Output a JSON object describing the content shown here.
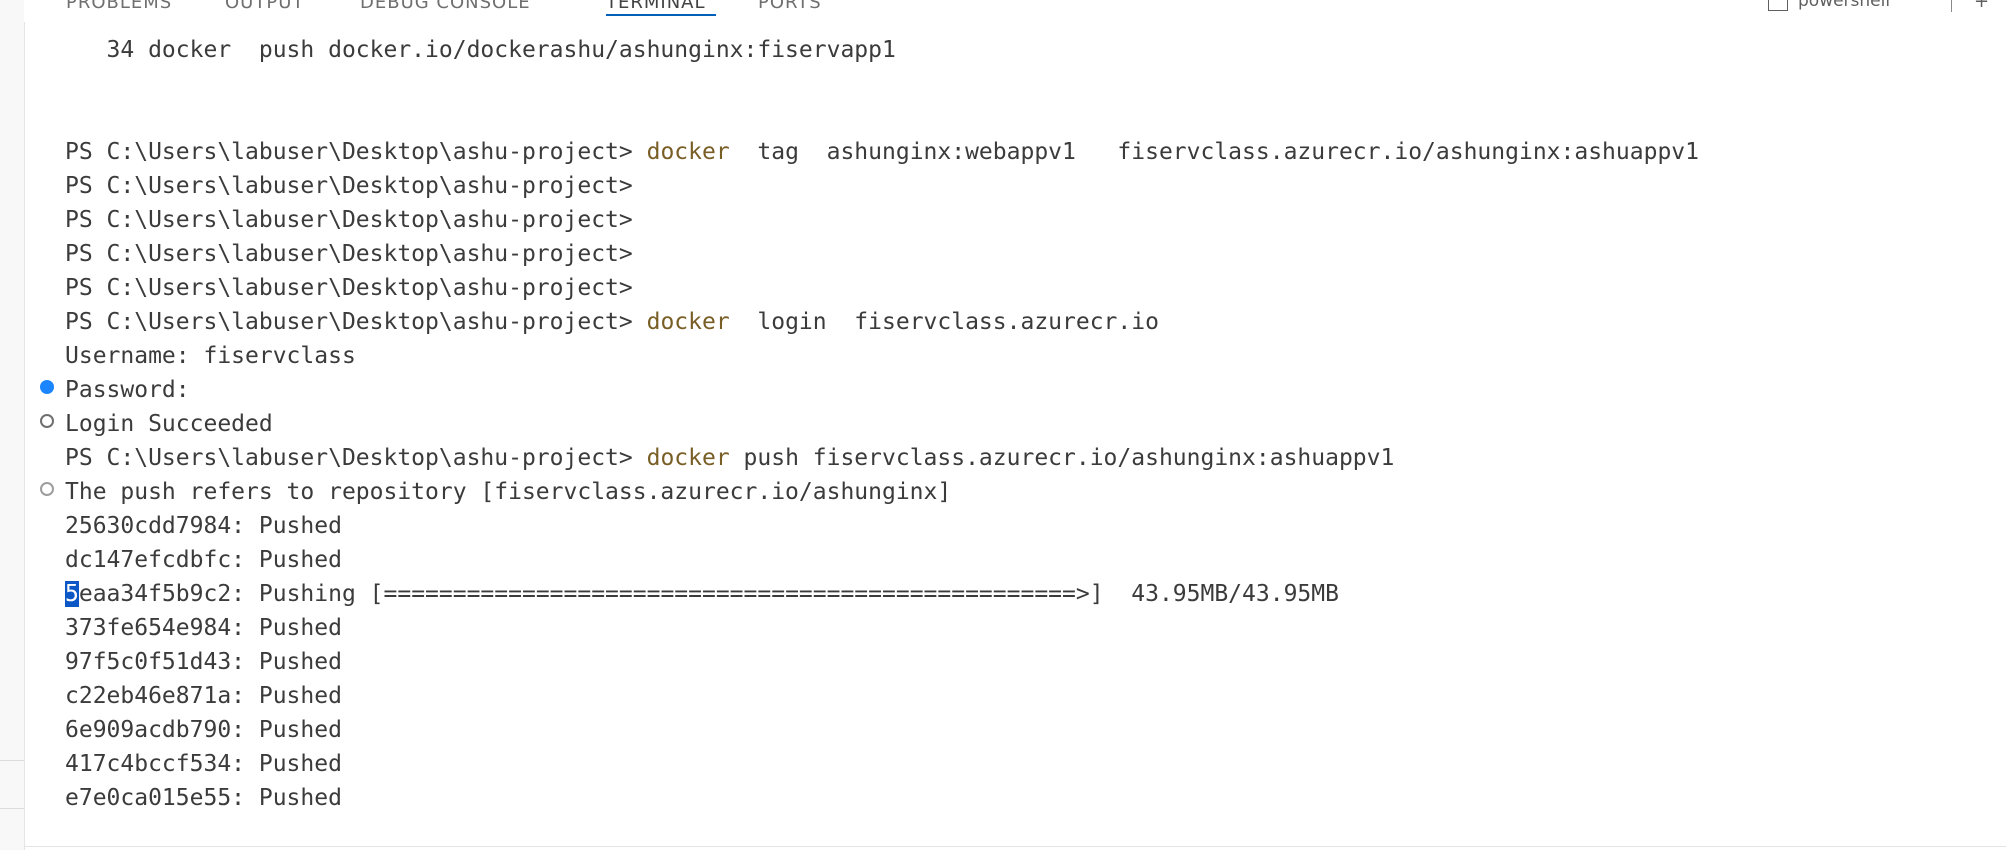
{
  "panel_tabs": [
    {
      "label": "PROBLEMS",
      "active": false
    },
    {
      "label": "OUTPUT",
      "active": false
    },
    {
      "label": "DEBUG CONSOLE",
      "active": false
    },
    {
      "label": "TERMINAL",
      "active": true
    },
    {
      "label": "PORTS",
      "active": false
    }
  ],
  "terminal_selector": {
    "label": "powershell",
    "icon": "terminal-icon"
  },
  "header_actions": {
    "add_icon": "plus-icon",
    "more_icon": "chevron-down-icon"
  },
  "colors": {
    "command": "#795e26",
    "text": "#3b3b3b",
    "decoration_success": "#1a85ff",
    "cursor_background": "#0b57c5",
    "active_tab_underline": "#005fb8"
  },
  "terminal": {
    "history_line": "   34 docker  push docker.io/dockerashu/ashunginx:fiservapp1",
    "prompt": "PS C:\\Users\\labuser\\Desktop\\ashu-project> ",
    "cmd_tag_word": "docker",
    "cmd_tag_args": "  tag  ashunginx:webappv1   fiservclass.azurecr.io/ashunginx:ashuappv1",
    "cmd_login_word": "docker",
    "cmd_login_args": "  login  fiservclass.azurecr.io",
    "username_line": "Username: fiservclass",
    "password_line": "Password:",
    "login_result": "Login Succeeded",
    "cmd_push_word": "docker",
    "cmd_push_args": " push fiservclass.azurecr.io/ashunginx:ashuappv1",
    "push_refers": "The push refers to repository [fiservclass.azurecr.io/ashunginx]",
    "layers_before": [
      "25630cdd7984: Pushed",
      "dc147efcdbfc: Pushed"
    ],
    "pushing_cursor_char": "5",
    "pushing_rest": "eaa34f5b9c2: Pushing [==================================================>]  43.95MB/43.95MB",
    "layers_after": [
      "373fe654e984: Pushed",
      "97f5c0f51d43: Pushed",
      "c22eb46e871a: Pushed",
      "6e909acdb790: Pushed",
      "417c4bccf534: Pushed",
      "e7e0ca015e55: Pushed"
    ]
  }
}
